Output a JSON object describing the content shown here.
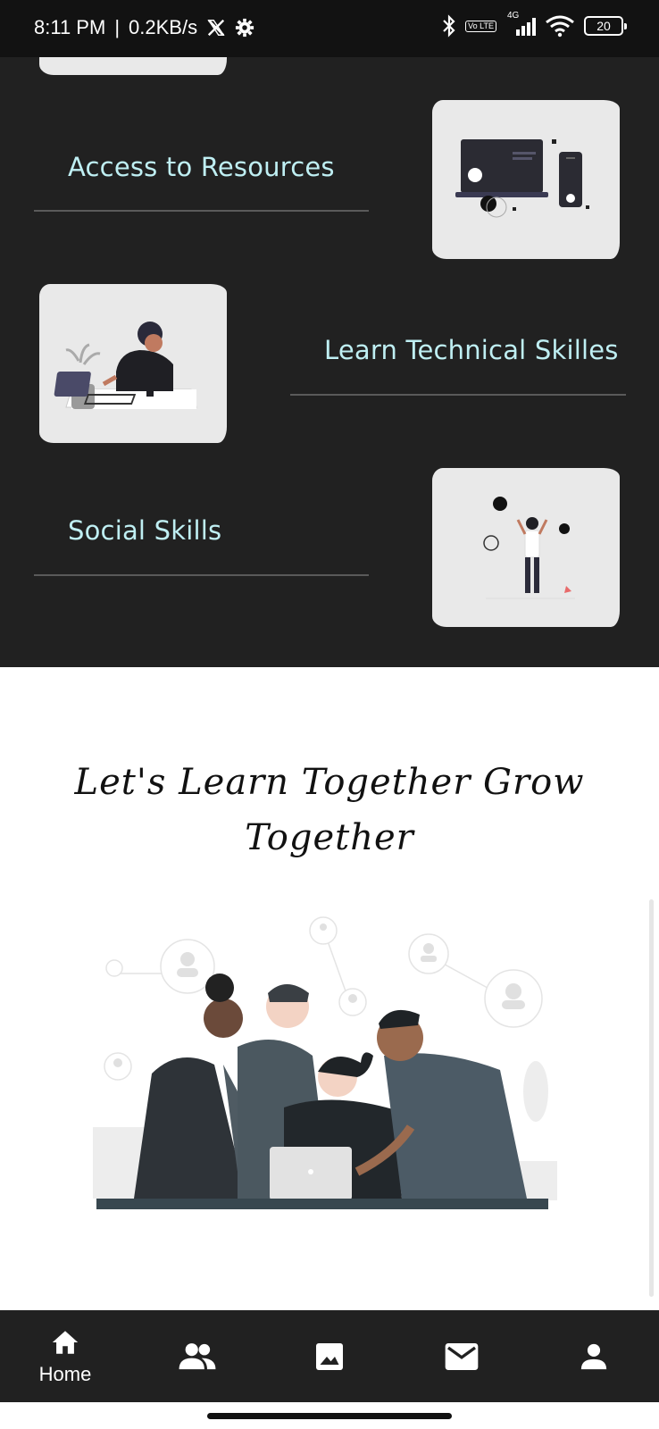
{
  "status_bar": {
    "time": "8:11 PM",
    "separator": "|",
    "network_speed": "0.2KB/s",
    "app_icon": "x-logo-icon",
    "settings_icon": "gear-icon",
    "network_type": "4G",
    "volte_label": "Vo LTE",
    "battery_level": "20",
    "battery_fraction": 0.2
  },
  "features": {
    "items": [
      {
        "title": "Access to Resources",
        "image": "devices-illustration"
      },
      {
        "title": "Learn Technical Skilles",
        "image": "person-at-desk-illustration"
      },
      {
        "title": "Social Skills",
        "image": "person-juggling-illustration"
      }
    ]
  },
  "community": {
    "headline_line1": "Let's Learn Together Grow",
    "headline_line2": "Together",
    "image": "team-collaboration-illustration"
  },
  "bottom_nav": {
    "items": [
      {
        "label": "Home",
        "icon": "home-icon",
        "active": true
      },
      {
        "label": "",
        "icon": "people-icon"
      },
      {
        "label": "",
        "icon": "image-icon"
      },
      {
        "label": "",
        "icon": "mail-icon"
      },
      {
        "label": "",
        "icon": "person-icon"
      }
    ]
  },
  "colors": {
    "dark_bg": "#212121",
    "accent_text": "#bfeff3",
    "card_bg": "#e9e9e9",
    "status_bg": "#121212"
  }
}
